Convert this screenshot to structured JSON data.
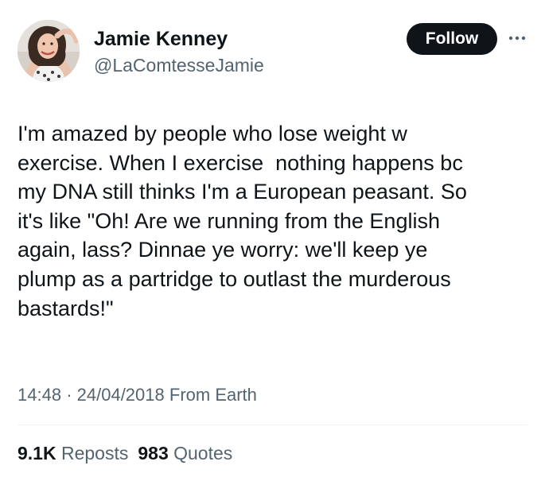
{
  "author": {
    "display_name": "Jamie Kenney",
    "handle": "@LaComtesseJamie"
  },
  "actions": {
    "follow_label": "Follow",
    "more_icon": "more-horizontal-icon"
  },
  "tweet": {
    "lines": [
      "I'm amazed by people who lose weight w",
      "exercise. When I exercise  nothing happens bc",
      "my DNA still thinks I'm a European peasant. So",
      "it's like \"Oh! Are we running from the English",
      "again, lass? Dinnae ye worry: we'll keep ye",
      "plump as a partridge to outlast the murderous",
      "bastards!\""
    ],
    "time": "14:48",
    "separator": "·",
    "date": "24/04/2018",
    "source": "From Earth"
  },
  "stats": {
    "reposts_count": "9.1K",
    "reposts_label": "Reposts",
    "quotes_count": "983",
    "quotes_label": "Quotes"
  },
  "colors": {
    "text": "#0f1419",
    "secondary": "#536471",
    "follow_bg": "#0f1419",
    "divider": "#eff3f4"
  }
}
